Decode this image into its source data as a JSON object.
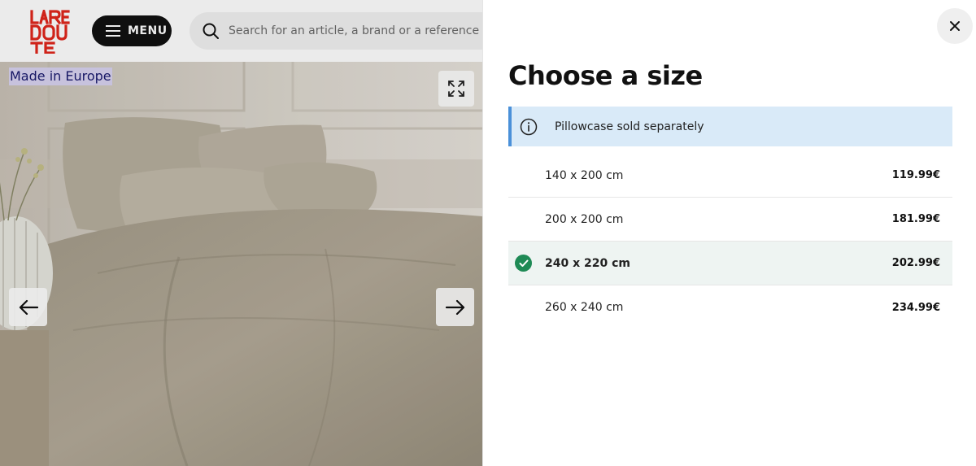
{
  "header": {
    "logo_text": "LA REDOUTE",
    "menu_label": "MENU",
    "search_placeholder": "Search for an article, a brand or a reference nu"
  },
  "product": {
    "badge": "Made in Europe"
  },
  "drawer": {
    "title": "Choose a size",
    "info": "Pillowcase sold separately",
    "sizes": [
      {
        "label": "140 x 200 cm",
        "price": "119.99€",
        "selected": false
      },
      {
        "label": "200 x 200 cm",
        "price": "181.99€",
        "selected": false
      },
      {
        "label": "240 x 220 cm",
        "price": "202.99€",
        "selected": true
      },
      {
        "label": "260 x 240 cm",
        "price": "234.99€",
        "selected": false
      }
    ]
  },
  "colors": {
    "brand_red": "#e1261c",
    "selected_check": "#1e8a55",
    "info_bg": "#d9eaf8",
    "info_accent": "#4a90d9"
  },
  "icons": {
    "menu": "hamburger-icon",
    "search": "search-icon",
    "expand": "expand-icon",
    "prev": "arrow-left-icon",
    "next": "arrow-right-icon",
    "close": "close-icon",
    "info": "info-icon",
    "check": "check-icon"
  }
}
